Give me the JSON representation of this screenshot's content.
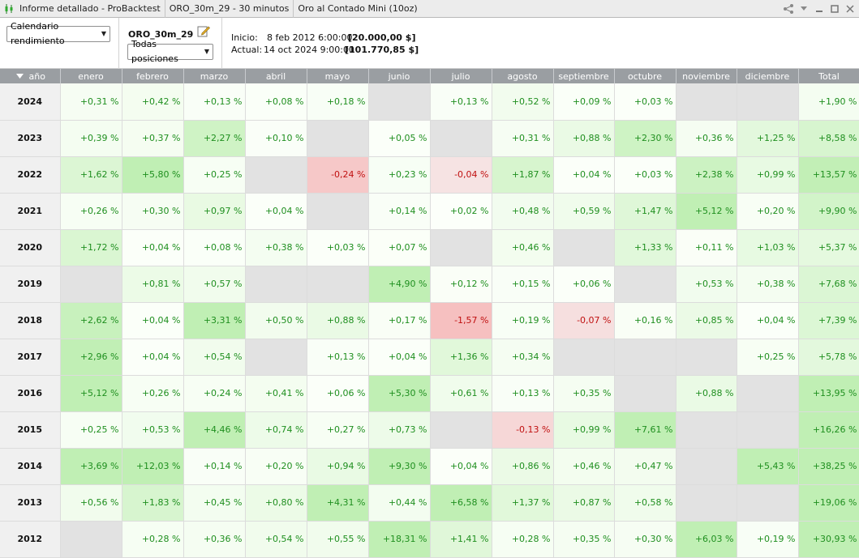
{
  "window": {
    "title_segments": [
      "Informe detallado - ProBacktest",
      "ORO_30m_29 - 30 minutos",
      "Oro al Contado Mini (10oz)"
    ]
  },
  "toolbar": {
    "calendar_select": "Calendario rendimiento",
    "strategy_name": "ORO_30m_29",
    "positions_select": "Todas posiciones",
    "start_label": "Inicio:",
    "start_date": "8 feb 2012 6:00:00",
    "start_value": "[20.000,00 $]",
    "current_label": "Actual:",
    "current_date": "14 oct 2024 9:00:00",
    "current_value": "[101.770,85 $]"
  },
  "colors": {
    "header_bg": "#9a9ea2",
    "positive_text": "#1f8f1f",
    "negative_text": "#c01010",
    "empty_cell": "#e2e2e2"
  },
  "table": {
    "year_header": "año",
    "columns": [
      "enero",
      "febrero",
      "marzo",
      "abril",
      "mayo",
      "junio",
      "julio",
      "agosto",
      "septiembre",
      "octubre",
      "noviembre",
      "diciembre",
      "Total"
    ],
    "rows": [
      {
        "year": "2024",
        "cells": [
          "+0,31 %",
          "+0,42 %",
          "+0,13 %",
          "+0,08 %",
          "+0,18 %",
          "",
          "+0,13 %",
          "+0,52 %",
          "+0,09 %",
          "+0,03 %",
          "",
          "",
          "+1,90 %"
        ]
      },
      {
        "year": "2023",
        "cells": [
          "+0,39 %",
          "+0,37 %",
          "+2,27 %",
          "+0,10 %",
          "",
          "+0,05 %",
          "",
          "+0,31 %",
          "+0,88 %",
          "+2,30 %",
          "+0,36 %",
          "+1,25 %",
          "+8,58 %"
        ]
      },
      {
        "year": "2022",
        "cells": [
          "+1,62 %",
          "+5,80 %",
          "+0,25 %",
          "",
          "-0,24 %",
          "+0,23 %",
          "-0,04 %",
          "+1,87 %",
          "+0,04 %",
          "+0,03 %",
          "+2,38 %",
          "+0,99 %",
          "+13,57 %"
        ]
      },
      {
        "year": "2021",
        "cells": [
          "+0,26 %",
          "+0,30 %",
          "+0,97 %",
          "+0,04 %",
          "",
          "+0,14 %",
          "+0,02 %",
          "+0,48 %",
          "+0,59 %",
          "+1,47 %",
          "+5,12 %",
          "+0,20 %",
          "+9,90 %"
        ]
      },
      {
        "year": "2020",
        "cells": [
          "+1,72 %",
          "+0,04 %",
          "+0,08 %",
          "+0,38 %",
          "+0,03 %",
          "+0,07 %",
          "",
          "+0,46 %",
          "",
          "+1,33 %",
          "+0,11 %",
          "+1,03 %",
          "+5,37 %"
        ]
      },
      {
        "year": "2019",
        "cells": [
          "",
          "+0,81 %",
          "+0,57 %",
          "",
          "",
          "+4,90 %",
          "+0,12 %",
          "+0,15 %",
          "+0,06 %",
          "",
          "+0,53 %",
          "+0,38 %",
          "+7,68 %"
        ]
      },
      {
        "year": "2018",
        "cells": [
          "+2,62 %",
          "+0,04 %",
          "+3,31 %",
          "+0,50 %",
          "+0,88 %",
          "+0,17 %",
          "-1,57 %",
          "+0,19 %",
          "-0,07 %",
          "+0,16 %",
          "+0,85 %",
          "+0,04 %",
          "+7,39 %"
        ]
      },
      {
        "year": "2017",
        "cells": [
          "+2,96 %",
          "+0,04 %",
          "+0,54 %",
          "",
          "+0,13 %",
          "+0,04 %",
          "+1,36 %",
          "+0,34 %",
          "",
          "",
          "",
          "+0,25 %",
          "+5,78 %"
        ]
      },
      {
        "year": "2016",
        "cells": [
          "+5,12 %",
          "+0,26 %",
          "+0,24 %",
          "+0,41 %",
          "+0,06 %",
          "+5,30 %",
          "+0,61 %",
          "+0,13 %",
          "+0,35 %",
          "",
          "+0,88 %",
          "",
          "+13,95 %"
        ]
      },
      {
        "year": "2015",
        "cells": [
          "+0,25 %",
          "+0,53 %",
          "+4,46 %",
          "+0,74 %",
          "+0,27 %",
          "+0,73 %",
          "",
          "-0,13 %",
          "+0,99 %",
          "+7,61 %",
          "",
          "",
          "+16,26 %"
        ]
      },
      {
        "year": "2014",
        "cells": [
          "+3,69 %",
          "+12,03 %",
          "+0,14 %",
          "+0,20 %",
          "+0,94 %",
          "+9,30 %",
          "+0,04 %",
          "+0,86 %",
          "+0,46 %",
          "+0,47 %",
          "",
          "+5,43 %",
          "+38,25 %"
        ]
      },
      {
        "year": "2013",
        "cells": [
          "+0,56 %",
          "+1,83 %",
          "+0,45 %",
          "+0,80 %",
          "+4,31 %",
          "+0,44 %",
          "+6,58 %",
          "+1,37 %",
          "+0,87 %",
          "+0,58 %",
          "",
          "",
          "+19,06 %"
        ]
      },
      {
        "year": "2012",
        "cells": [
          "",
          "+0,28 %",
          "+0,36 %",
          "+0,54 %",
          "+0,55 %",
          "+18,31 %",
          "+1,41 %",
          "+0,28 %",
          "+0,35 %",
          "+0,30 %",
          "+6,03 %",
          "+0,19 %",
          "+30,93 %"
        ]
      }
    ]
  }
}
